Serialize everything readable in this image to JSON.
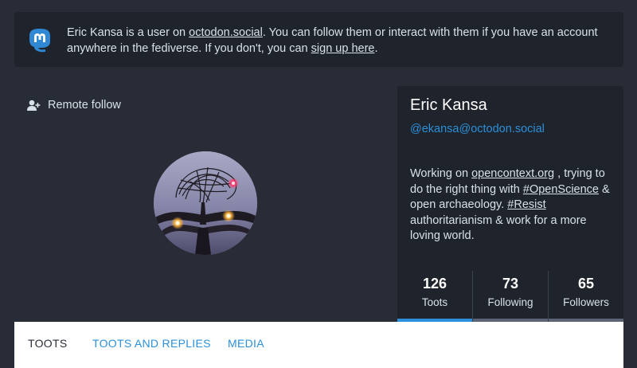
{
  "banner": {
    "text_before": "Eric Kansa is a user on ",
    "domain_link": "octodon.social",
    "text_middle": ". You can follow them or interact with them if you have an account anywhere in the fediverse. If you don't, you can ",
    "signup_link": "sign up here",
    "text_end": "."
  },
  "remote_follow": {
    "label": "Remote follow",
    "icon": "add-user-icon"
  },
  "profile": {
    "name": "Eric Kansa",
    "handle": "@ekansa@octodon.social",
    "bio": {
      "p1": "Working on ",
      "link1": "opencontext.org",
      "p2": " , trying to do the right thing with ",
      "tag1": "#OpenScience",
      "p3": " & open archaeology. ",
      "tag2": "#Resist",
      "p4": " authoritarianism & work for a more loving world."
    }
  },
  "counters": [
    {
      "value": "126",
      "label": "Toots",
      "active": true
    },
    {
      "value": "73",
      "label": "Following",
      "active": false
    },
    {
      "value": "65",
      "label": "Followers",
      "active": false
    }
  ],
  "tabs": [
    {
      "label": "TOOTS",
      "active": true
    },
    {
      "label": "TOOTS AND REPLIES",
      "active": false
    },
    {
      "label": "MEDIA",
      "active": false
    }
  ],
  "colors": {
    "background": "#282c37",
    "panel": "#1f232b",
    "accent": "#2b90d9",
    "text": "#d9e1e8"
  }
}
